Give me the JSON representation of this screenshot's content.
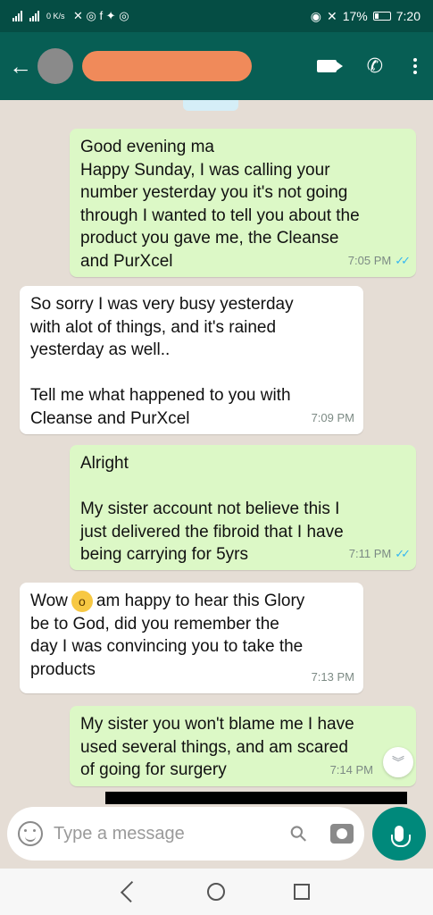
{
  "status_bar": {
    "battery": "17%",
    "time": "7:20",
    "speed": "0 K/s"
  },
  "header": {
    "icons": [
      "back-arrow-icon",
      "video-call-icon",
      "voice-call-icon",
      "more-options-icon"
    ]
  },
  "messages": [
    {
      "direction": "outgoing",
      "text": "Good evening ma\nHappy Sunday, I was calling your\nnumber yesterday you it's not going\nthrough I wanted to tell you about the\nproduct you gave me, the Cleanse\nand PurXcel",
      "time": "7:05 PM",
      "status": "read"
    },
    {
      "direction": "incoming",
      "text": "So sorry I was very busy yesterday\nwith alot of things, and it's rained\nyesterday as well..\n\nTell me what happened to you with\nCleanse and PurXcel",
      "time": "7:09 PM"
    },
    {
      "direction": "outgoing",
      "text": "Alright\n\nMy sister account not believe this I\njust delivered the fibroid that I  have\nbeing carrying for 5yrs",
      "time": "7:11 PM",
      "status": "read"
    },
    {
      "direction": "incoming",
      "text_before_emoji": "Wow",
      "text_after_emoji": "am happy to hear this Glory\nbe to God,  did you remember the\nday I was convincing you to take the\nproducts",
      "time": "7:13 PM"
    },
    {
      "direction": "outgoing",
      "text": "My sister you won't blame me I have\nused several things, and am scared\nof going for surgery",
      "time": "7:14 PM"
    }
  ],
  "composer": {
    "placeholder": "Type a message"
  },
  "colors": {
    "header": "#075e54",
    "outgoing_bubble": "#dcf8c6",
    "incoming_bubble": "#ffffff",
    "read_ticks": "#34b7f1",
    "mic_button": "#00897b"
  }
}
